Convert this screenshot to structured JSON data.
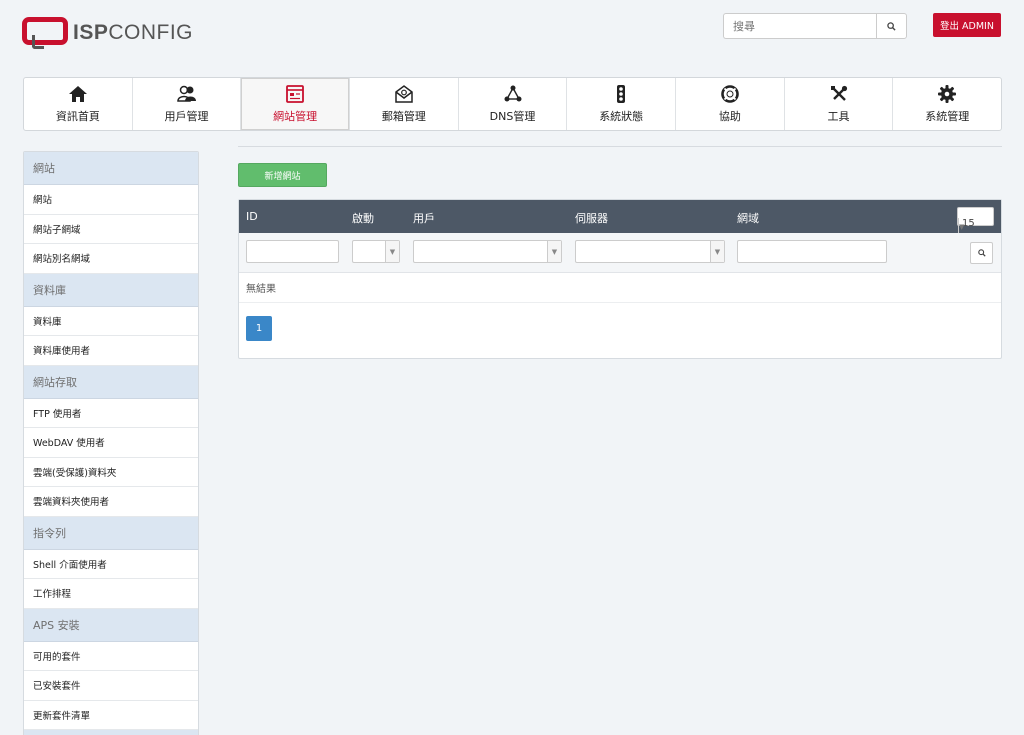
{
  "header": {
    "logo": {
      "bold": "ISP",
      "light": "CONFIG"
    },
    "search": {
      "placeholder": "搜尋",
      "icon": "search-icon"
    },
    "logout_label": "登出 ADMIN"
  },
  "colors": {
    "brand_red": "#c8102e",
    "green_button": "#61bd6d",
    "table_header": "#4d5866",
    "pager_active": "#3a87c8"
  },
  "nav": {
    "items": [
      {
        "label": "資訊首頁",
        "icon": "home-icon"
      },
      {
        "label": "用戶管理",
        "icon": "users-icon"
      },
      {
        "label": "網站管理",
        "icon": "website-icon",
        "active": true
      },
      {
        "label": "郵箱管理",
        "icon": "mail-icon"
      },
      {
        "label": "DNS管理",
        "icon": "dns-icon"
      },
      {
        "label": "系統狀態",
        "icon": "traffic-light-icon"
      },
      {
        "label": "協助",
        "icon": "lifebuoy-icon"
      },
      {
        "label": "工具",
        "icon": "tools-icon"
      },
      {
        "label": "系統管理",
        "icon": "gear-icon"
      }
    ]
  },
  "sidebar": {
    "sections": [
      {
        "title": "網站",
        "items": [
          "網站",
          "網站子網域",
          "網站別名網域"
        ]
      },
      {
        "title": "資料庫",
        "items": [
          "資料庫",
          "資料庫使用者"
        ]
      },
      {
        "title": "網站存取",
        "items": [
          "FTP 使用者",
          "WebDAV 使用者",
          "雲端(受保護)資料夾",
          "雲端資料夾使用者"
        ]
      },
      {
        "title": "指令列",
        "items": [
          "Shell 介面使用者",
          "工作排程"
        ]
      },
      {
        "title": "APS 安裝",
        "items": [
          "可用的套件",
          "已安裝套件",
          "更新套件清單"
        ]
      }
    ]
  },
  "main": {
    "add_button": "新增網站",
    "table": {
      "columns": [
        "ID",
        "啟動",
        "用戶",
        "伺服器",
        "網域"
      ],
      "page_size": "15",
      "no_results": "無結果",
      "current_page": "1"
    }
  }
}
